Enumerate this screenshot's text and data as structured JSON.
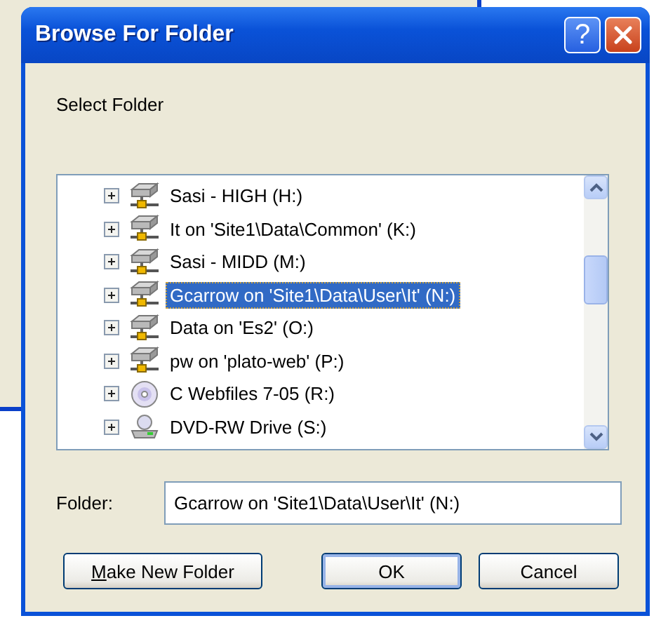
{
  "window": {
    "title": "Browse For Folder",
    "help_button": "?"
  },
  "instruction": "Select Folder",
  "tree": {
    "items": [
      {
        "kind": "network_drive",
        "label": "Sasi - HIGH (H:)",
        "expandable": true,
        "selected": false
      },
      {
        "kind": "network_drive",
        "label": "It on 'Site1\\Data\\Common' (K:)",
        "expandable": true,
        "selected": false
      },
      {
        "kind": "network_drive",
        "label": "Sasi - MIDD (M:)",
        "expandable": true,
        "selected": false
      },
      {
        "kind": "network_drive",
        "label": "Gcarrow on 'Site1\\Data\\User\\It' (N:)",
        "expandable": true,
        "selected": true
      },
      {
        "kind": "network_drive",
        "label": "Data on 'Es2' (O:)",
        "expandable": true,
        "selected": false
      },
      {
        "kind": "network_drive",
        "label": "pw on 'plato-web' (P:)",
        "expandable": true,
        "selected": false
      },
      {
        "kind": "cd",
        "label": "C Webfiles 7-05 (R:)",
        "expandable": true,
        "selected": false
      },
      {
        "kind": "dvd",
        "label": "DVD-RW Drive (S:)",
        "expandable": true,
        "selected": false
      }
    ]
  },
  "folder": {
    "label": "Folder:",
    "value": "Gcarrow on 'Site1\\Data\\User\\It' (N:)"
  },
  "buttons": [
    {
      "kind": "make_folder",
      "label": "Make New Folder",
      "underline_first": true,
      "default": false
    },
    {
      "kind": "ok",
      "label": "OK",
      "underline_first": false,
      "default": true
    },
    {
      "kind": "cancel",
      "label": "Cancel",
      "underline_first": false,
      "default": false
    }
  ]
}
